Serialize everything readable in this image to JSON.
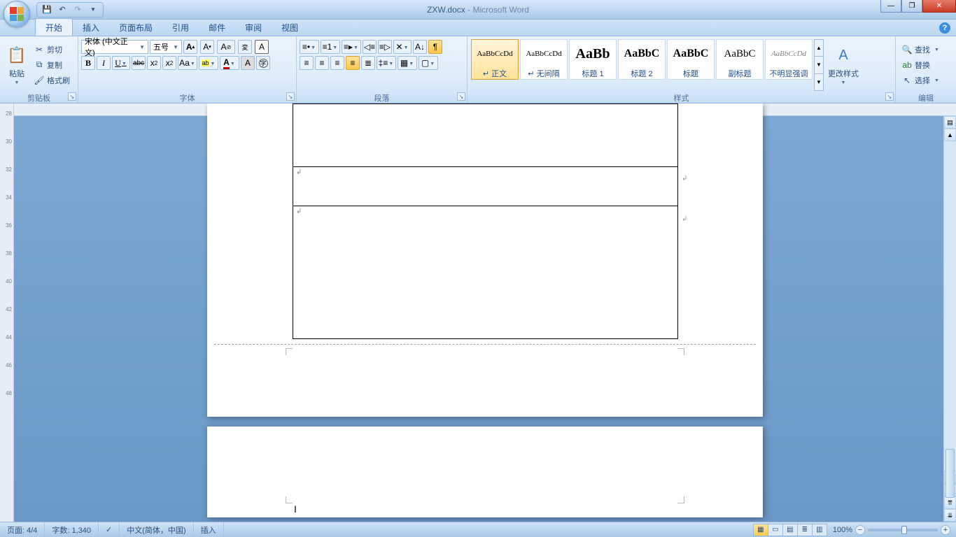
{
  "title": {
    "doc": "ZXW.docx",
    "app": "Microsoft Word"
  },
  "qat": [
    "save",
    "undo",
    "redo",
    "more"
  ],
  "tabs": [
    "开始",
    "插入",
    "页面布局",
    "引用",
    "邮件",
    "审阅",
    "视图"
  ],
  "active_tab": 0,
  "ribbon": {
    "clipboard": {
      "label": "剪贴板",
      "paste": "粘贴",
      "cut": "剪切",
      "copy": "复制",
      "format_painter": "格式刷"
    },
    "font": {
      "label": "字体",
      "font_name": "宋体 (中文正文)",
      "font_size": "五号",
      "grow": "A",
      "shrink": "A",
      "clear_format": "Aa",
      "phonetic": "拼",
      "char_border": "A",
      "bold": "B",
      "italic": "I",
      "underline": "U",
      "strike": "abc",
      "sub": "x₂",
      "sup": "x²",
      "case": "Aa",
      "highlight": "aby",
      "font_color": "A",
      "char_shading": "A",
      "enclose": "字"
    },
    "paragraph": {
      "label": "段落"
    },
    "styles": {
      "label": "样式",
      "change_styles": "更改样式",
      "items": [
        {
          "preview": "AaBbCcDd",
          "name": "正文",
          "size": "11px",
          "sel": true,
          "prefix": "↵"
        },
        {
          "preview": "AaBbCcDd",
          "name": "无间隔",
          "size": "11px",
          "prefix": "↵"
        },
        {
          "preview": "AaBb",
          "name": "标题 1",
          "size": "20px",
          "bold": true
        },
        {
          "preview": "AaBbC",
          "name": "标题 2",
          "size": "16px",
          "bold": true
        },
        {
          "preview": "AaBbC",
          "name": "标题",
          "size": "16px",
          "bold": true
        },
        {
          "preview": "AaBbC",
          "name": "副标题",
          "size": "15px"
        },
        {
          "preview": "AaBbCcDd",
          "name": "不明显强调",
          "size": "11px",
          "italic": true,
          "color": "#888"
        }
      ]
    },
    "editing": {
      "label": "编辑",
      "find": "查找",
      "replace": "替换",
      "select": "选择"
    }
  },
  "ruler_ticks": [
    "28",
    "30",
    "32",
    "34",
    "36",
    "38",
    "40",
    "42",
    "44",
    "46",
    "48"
  ],
  "statusbar": {
    "page": "页面: 4/4",
    "words": "字数: 1,340",
    "lang": "中文(简体，中国)",
    "mode": "插入",
    "zoom": "100%"
  }
}
